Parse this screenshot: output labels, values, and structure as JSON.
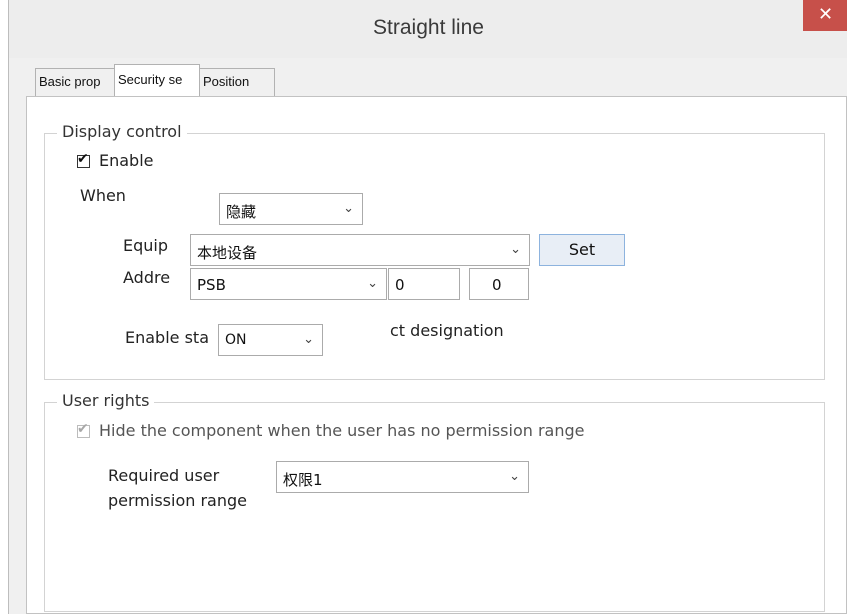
{
  "window": {
    "title": "Straight line",
    "close_glyph": "✕"
  },
  "tabs": [
    {
      "label": "Basic prop"
    },
    {
      "label": "Security se"
    },
    {
      "label": "Position"
    }
  ],
  "display_control": {
    "group_label": "Display control",
    "enable_label": "Enable",
    "enable_checked": true,
    "when_label": "When",
    "when_value": "隐藏",
    "equip_label": "Equip",
    "equip_value": "本地设备",
    "set_label": "Set",
    "addre_label": "Addre",
    "addre_type_value": "PSB",
    "addre_field1": "0",
    "addre_field2": "0",
    "enable_state_label": "Enable sta",
    "enable_state_value": "ON",
    "designation_text": "ct designation"
  },
  "user_rights": {
    "group_label": "User rights",
    "hide_label": "Hide the component when the user has no permission range",
    "hide_checked": true,
    "required_label_line1": "Required user",
    "required_label_line2": "permission range",
    "permission_value": "权限1"
  },
  "icons": {
    "check": "✔",
    "dropdown": "⌄"
  }
}
